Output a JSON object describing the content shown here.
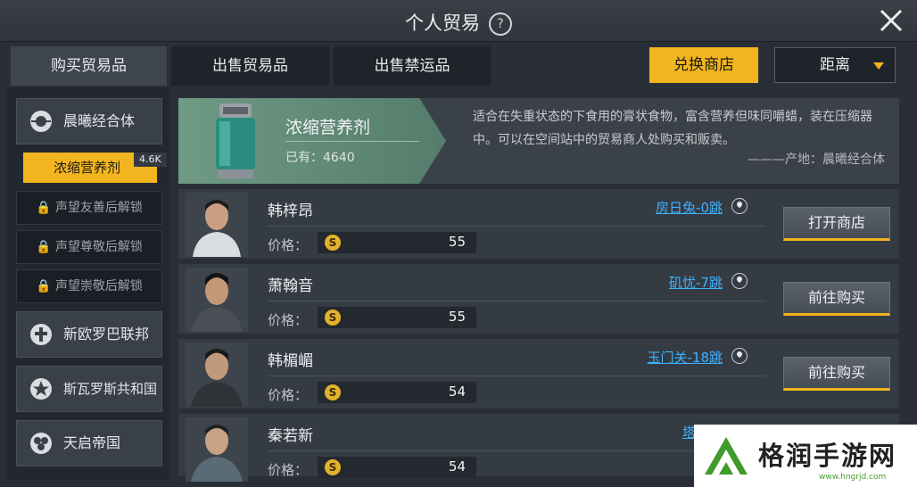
{
  "window": {
    "title": "个人贸易",
    "help_icon": "question-icon",
    "close_icon": "close-icon"
  },
  "tabs": [
    {
      "label": "购买贸易品",
      "active": true
    },
    {
      "label": "出售贸易品",
      "active": false
    },
    {
      "label": "出售禁运品",
      "active": false
    }
  ],
  "header_buttons": {
    "exchange_label": "兑换商店",
    "sort_label": "距离",
    "accent_color": "#f2b51f"
  },
  "sidebar": {
    "factions": [
      {
        "label": "晨曦经合体",
        "icon": "faction-orb-icon"
      },
      {
        "label": "新欧罗巴联邦",
        "icon": "faction-cross-icon"
      },
      {
        "label": "斯瓦罗斯共和国",
        "icon": "faction-star-icon"
      },
      {
        "label": "天启帝国",
        "icon": "faction-circles-icon"
      }
    ],
    "active_item": {
      "label": "浓缩营养剂",
      "badge": "4.6K"
    },
    "locked_items": [
      "声望友善后解锁",
      "声望尊敬后解锁",
      "声望崇敬后解锁"
    ]
  },
  "product": {
    "name": "浓缩营养剂",
    "owned": "已有：4640",
    "description": "适合在失重状态的下食用的膏状食物，富含营养但味同嚼蜡，装在压缩器中。可以在空间站中的贸易商人处购买和贩卖。",
    "origin": "———产地：晨曦经合体"
  },
  "traders": [
    {
      "name": "韩梓昂",
      "location": "房日兔-0跳",
      "price_label": "价格：",
      "price": "55",
      "action": "打开商店"
    },
    {
      "name": "萧翰音",
      "location": "矶忧-7跳",
      "price_label": "价格：",
      "price": "55",
      "action": "前往购买"
    },
    {
      "name": "韩楣嵋",
      "location": "玉门关-18跳",
      "price_label": "价格：",
      "price": "54",
      "action": "前往购买"
    },
    {
      "name": "秦若新",
      "location": "塔里木",
      "price_label": "价格：",
      "price": "54",
      "action": ""
    }
  ],
  "watermark": {
    "text": "格润手游网",
    "url": "www.hngrjd.com"
  }
}
